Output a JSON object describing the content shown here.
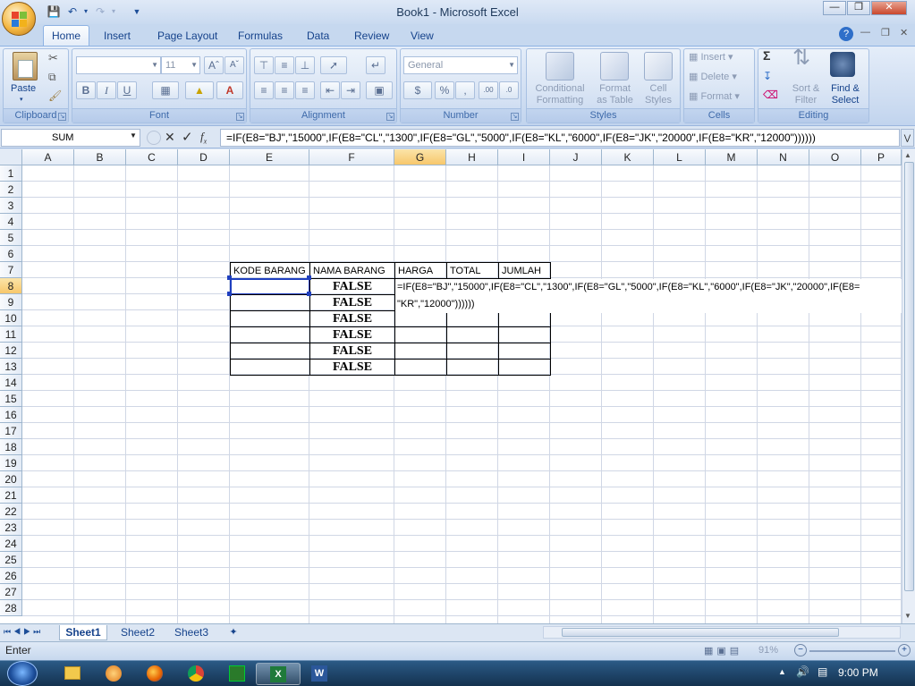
{
  "window": {
    "title": "Book1 - Microsoft Excel"
  },
  "ribbon": {
    "tabs": [
      "Home",
      "Insert",
      "Page Layout",
      "Formulas",
      "Data",
      "Review",
      "View"
    ],
    "active_tab": "Home",
    "clipboard": {
      "paste": "Paste",
      "label": "Clipboard"
    },
    "font": {
      "name": "",
      "size": "11",
      "label": "Font"
    },
    "alignment": {
      "label": "Alignment"
    },
    "number": {
      "format": "General",
      "label": "Number"
    },
    "styles": {
      "conditional_formatting": [
        "Conditional",
        "Formatting"
      ],
      "format_as_table": [
        "Format",
        "as Table"
      ],
      "cell_styles": [
        "Cell",
        "Styles"
      ],
      "label": "Styles"
    },
    "cells": {
      "insert": "Insert",
      "delete": "Delete",
      "format": "Format",
      "label": "Cells"
    },
    "editing": {
      "sort_filter": [
        "Sort &",
        "Filter"
      ],
      "find_select": [
        "Find &",
        "Select"
      ],
      "label": "Editing"
    }
  },
  "formula_bar": {
    "name_box": "SUM",
    "formula": "=IF(E8=\"BJ\",\"15000\",IF(E8=\"CL\",\"1300\",IF(E8=\"GL\",\"5000\",IF(E8=\"KL\",\"6000\",IF(E8=\"JK\",\"20000\",IF(E8=\"KR\",\"12000\"))))))"
  },
  "sheet": {
    "columns": [
      "A",
      "B",
      "C",
      "D",
      "E",
      "F",
      "G",
      "H",
      "I",
      "J",
      "K",
      "L",
      "M",
      "N",
      "O",
      "P"
    ],
    "active_column": "G",
    "rows": [
      "1",
      "2",
      "3",
      "4",
      "5",
      "6",
      "7",
      "8",
      "9",
      "10",
      "11",
      "12",
      "13",
      "14",
      "15",
      "16",
      "17",
      "18",
      "19",
      "20",
      "21",
      "22",
      "23",
      "24",
      "25",
      "26",
      "27",
      "28"
    ],
    "active_row": "8",
    "headers": [
      "KODE BARANG",
      "NAMA BARANG",
      "HARGA",
      "TOTAL",
      "JUMLAH"
    ],
    "nama_barang_values": [
      "FALSE",
      "FALSE",
      "FALSE",
      "FALSE",
      "FALSE",
      "FALSE"
    ],
    "edit_line1": "=IF(E8=\"BJ\",\"15000\",IF(E8=\"CL\",\"1300\",IF(E8=\"GL\",\"5000\",IF(E8=\"KL\",\"6000\",IF(E8=\"JK\",\"20000\",IF(E8=",
    "edit_line2": "\"KR\",\"12000\"))))))"
  },
  "sheet_tabs": [
    "Sheet1",
    "Sheet2",
    "Sheet3"
  ],
  "active_sheet": "Sheet1",
  "status": {
    "mode": "Enter",
    "zoom": "91%"
  },
  "taskbar": {
    "clock": "9:00 PM"
  },
  "colors": {
    "accent": "#15428b",
    "active_header": "#f7c76b",
    "selection": "#1f3fbf"
  }
}
